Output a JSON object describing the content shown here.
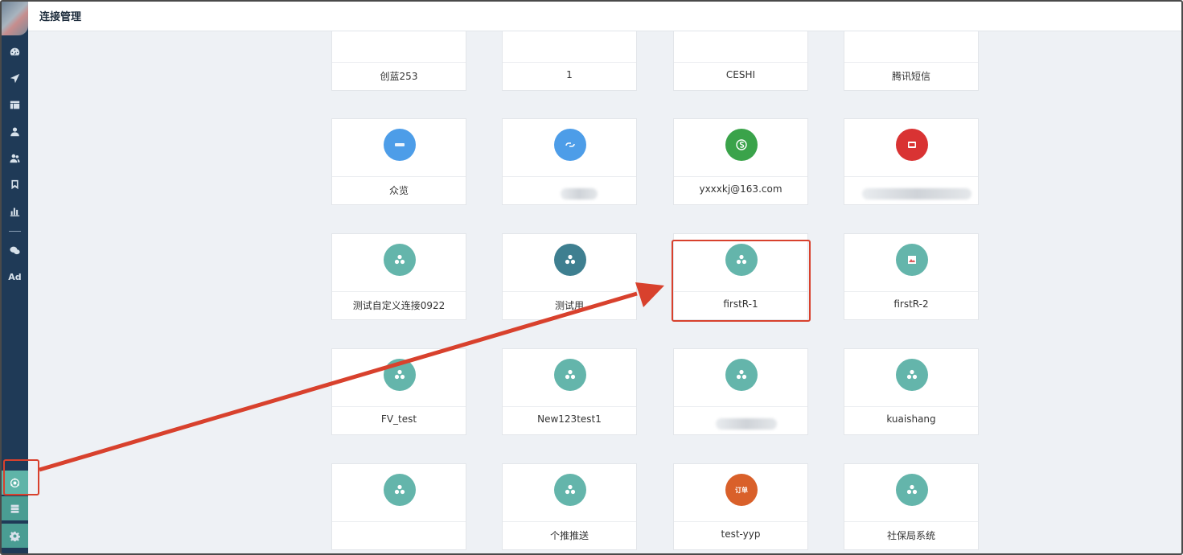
{
  "header": {
    "title": "连接管理"
  },
  "sidebar": {
    "items": [
      {
        "name": "dashboard-icon"
      },
      {
        "name": "send-icon"
      },
      {
        "name": "layout-icon"
      },
      {
        "name": "user-icon"
      },
      {
        "name": "users-icon"
      },
      {
        "name": "bookmark-icon"
      },
      {
        "name": "bar-chart-icon"
      },
      {
        "name": "wechat-icon"
      },
      {
        "name": "ad-icon",
        "label": "Ad"
      },
      {
        "name": "connector-icon",
        "active": true
      },
      {
        "name": "server-icon"
      },
      {
        "name": "gear-icon"
      }
    ]
  },
  "connections": [
    {
      "label": "创蓝253",
      "color": "#4a86e8",
      "icon": "link-icon"
    },
    {
      "label": "1",
      "color": "#6fa2d8",
      "icon": "link-icon"
    },
    {
      "label": "CESHI",
      "color": "#6fa2d8",
      "icon": "link-icon"
    },
    {
      "label": "腾讯短信",
      "color": "#6fa2d8",
      "icon": "link-icon"
    },
    {
      "label": "众览",
      "color": "#4d9de8",
      "icon": "logo-icon"
    },
    {
      "label": "",
      "color": "#4d9de8",
      "icon": "link-icon",
      "blurred": true
    },
    {
      "label": "yxxxkj@163.com",
      "color": "#3aa34a",
      "icon": "s-logo-icon"
    },
    {
      "label": "",
      "color": "#d93333",
      "icon": "red-logo-icon",
      "blurred": true
    },
    {
      "label": "测试自定义连接0922",
      "color": "#64b5ab",
      "icon": "custom-icon"
    },
    {
      "label": "测试用",
      "color": "#3e7f90",
      "icon": "custom-icon"
    },
    {
      "label": "firstR-1",
      "color": "#64b5ab",
      "icon": "custom-icon"
    },
    {
      "label": "firstR-2",
      "color": "#64b5ab",
      "icon": "image-icon"
    },
    {
      "label": "FV_test",
      "color": "#64b5ab",
      "icon": "custom-icon"
    },
    {
      "label": "New123test1",
      "color": "#64b5ab",
      "icon": "custom-icon"
    },
    {
      "label": "",
      "color": "#64b5ab",
      "icon": "custom-icon",
      "blurred": true
    },
    {
      "label": "kuaishang",
      "color": "#64b5ab",
      "icon": "custom-icon"
    },
    {
      "label": "",
      "color": "#64b5ab",
      "icon": "custom-icon"
    },
    {
      "label": "个推推送",
      "color": "#64b5ab",
      "icon": "custom-icon"
    },
    {
      "label": "test-yyp",
      "color": "#d9602a",
      "icon": "order-icon",
      "badge": "订单"
    },
    {
      "label": "社保局系统",
      "color": "#64b5ab",
      "icon": "custom-icon"
    }
  ],
  "colors": {
    "sidebar": "#1f3a57",
    "accent": "#5fb4a8",
    "annotation": "#d8412d"
  }
}
